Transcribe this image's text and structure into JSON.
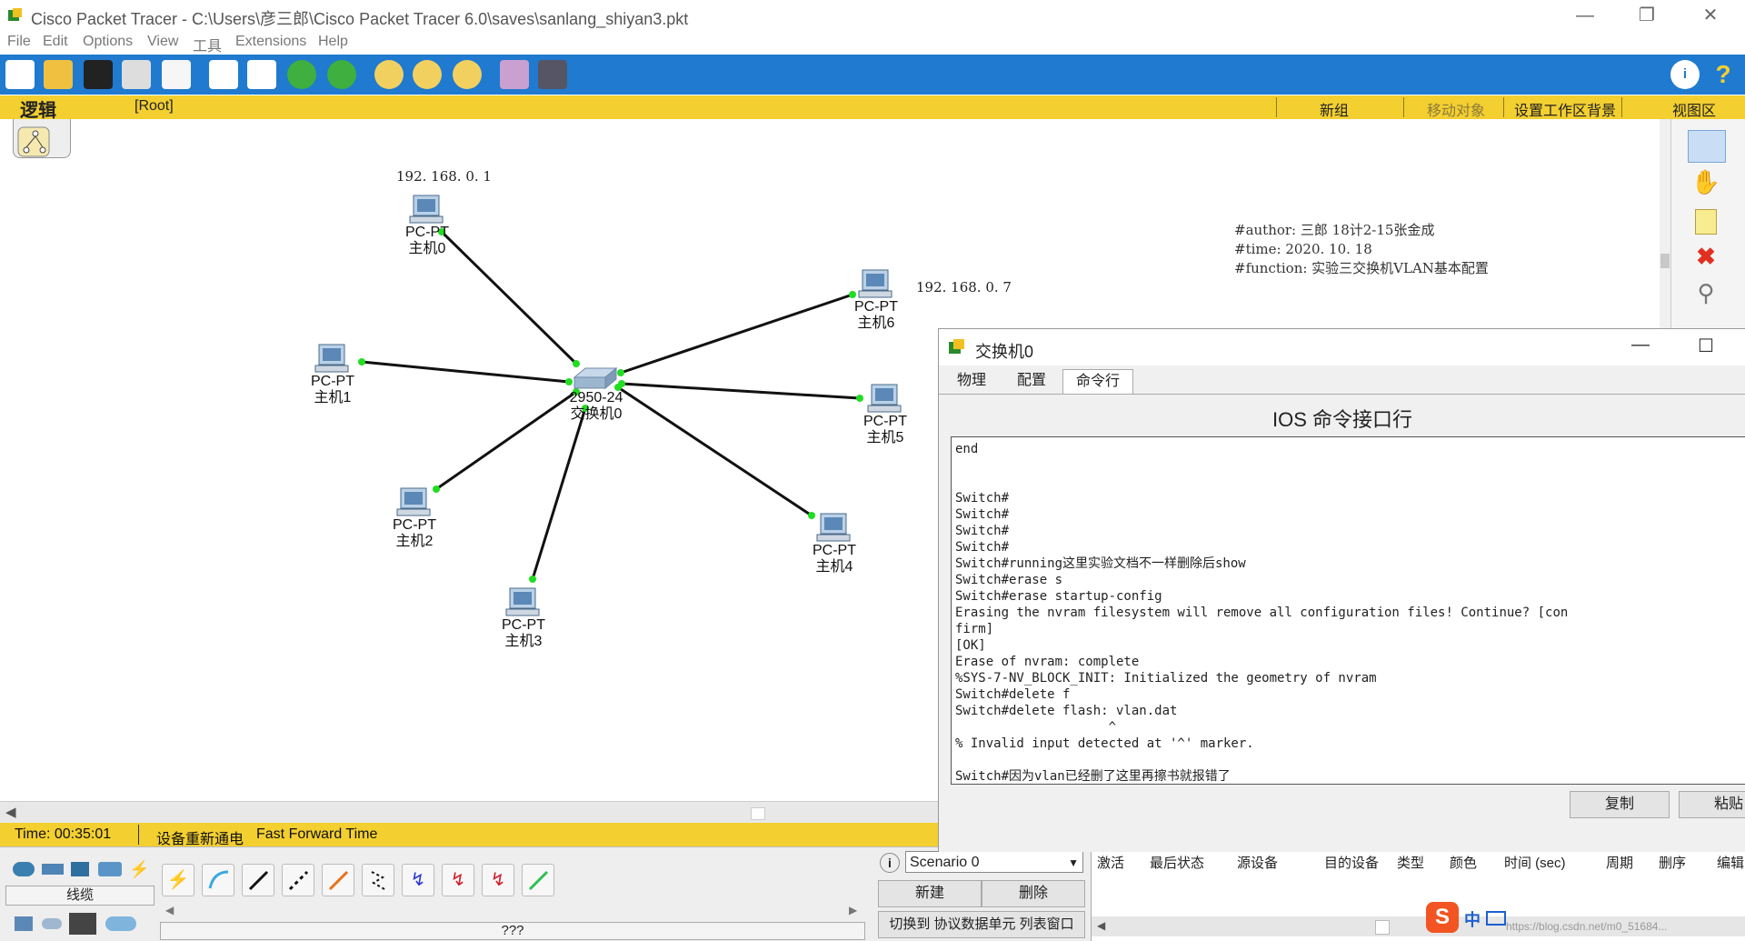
{
  "window": {
    "title": "Cisco Packet Tracer - C:\\Users\\彦三郎\\Cisco Packet Tracer 6.0\\saves\\sanlang_shiyan3.pkt"
  },
  "menu": [
    "File",
    "Edit",
    "Options",
    "View",
    "工具",
    "Extensions",
    "Help"
  ],
  "workspace_bar": {
    "mode_label": "逻辑",
    "root_label": "[Root]",
    "new_cluster": "新组",
    "move_object": "移动对象",
    "set_background": "设置工作区背景",
    "viewport": "视图区"
  },
  "topology": {
    "switch": {
      "model": "2950-24",
      "name": "交换机0"
    },
    "pcs": [
      {
        "type": "PC-PT",
        "name": "主机0"
      },
      {
        "type": "PC-PT",
        "name": "主机1"
      },
      {
        "type": "PC-PT",
        "name": "主机2"
      },
      {
        "type": "PC-PT",
        "name": "主机3"
      },
      {
        "type": "PC-PT",
        "name": "主机4"
      },
      {
        "type": "PC-PT",
        "name": "主机5"
      },
      {
        "type": "PC-PT",
        "name": "主机6"
      }
    ],
    "ip_labels": [
      "192. 168. 0. 1",
      "192. 168. 0. 7"
    ],
    "note_lines": [
      "#author: 三郎 18计2-15张金成",
      "#time: 2020. 10. 18",
      "#function: 实验三交换机VLAN基本配置"
    ]
  },
  "status": {
    "time": "Time: 00:35:01",
    "power_cycle": "设备重新通电",
    "fast_forward": "Fast Forward Time"
  },
  "bottom": {
    "device_category": "线缆",
    "device_name": "???",
    "scenario": "Scenario 0",
    "new_button": "新建",
    "delete_button": "删除",
    "toggle_pdu": "切换到 协议数据单元 列表窗口",
    "event_columns": [
      "激活",
      "最后状态",
      "源设备",
      "目的设备",
      "类型",
      "颜色",
      "时间 (sec)",
      "周期",
      "删序",
      "编辑"
    ],
    "watermark": "https://blog.csdn.net/m0_51684..."
  },
  "dialog": {
    "title": "交换机0",
    "tabs": [
      "物理",
      "配置",
      "命令行"
    ],
    "active_tab": "命令行",
    "heading": "IOS 命令接口行",
    "cli_lines": [
      "end",
      "",
      "",
      "Switch#",
      "Switch#",
      "Switch#",
      "Switch#",
      "Switch#running这里实验文档不一样删除后show",
      "Switch#erase s",
      "Switch#erase startup-config",
      "Erasing the nvram filesystem will remove all configuration files! Continue? [con",
      "firm]",
      "[OK]",
      "Erase of nvram: complete",
      "%SYS-7-NV_BLOCK_INIT: Initialized the geometry of nvram",
      "Switch#delete f",
      "Switch#delete flash: vlan.dat",
      "                    ^",
      "% Invalid input detected at '^' marker.",
      "",
      "Switch#因为vlan已经删了这里再擦书就报错了"
    ],
    "copy_button": "复制",
    "paste_button": "粘贴"
  },
  "colors": {
    "toolbar": "#1f7ad0",
    "bar": "#f3cf30",
    "link_dot": "#22dd22"
  }
}
